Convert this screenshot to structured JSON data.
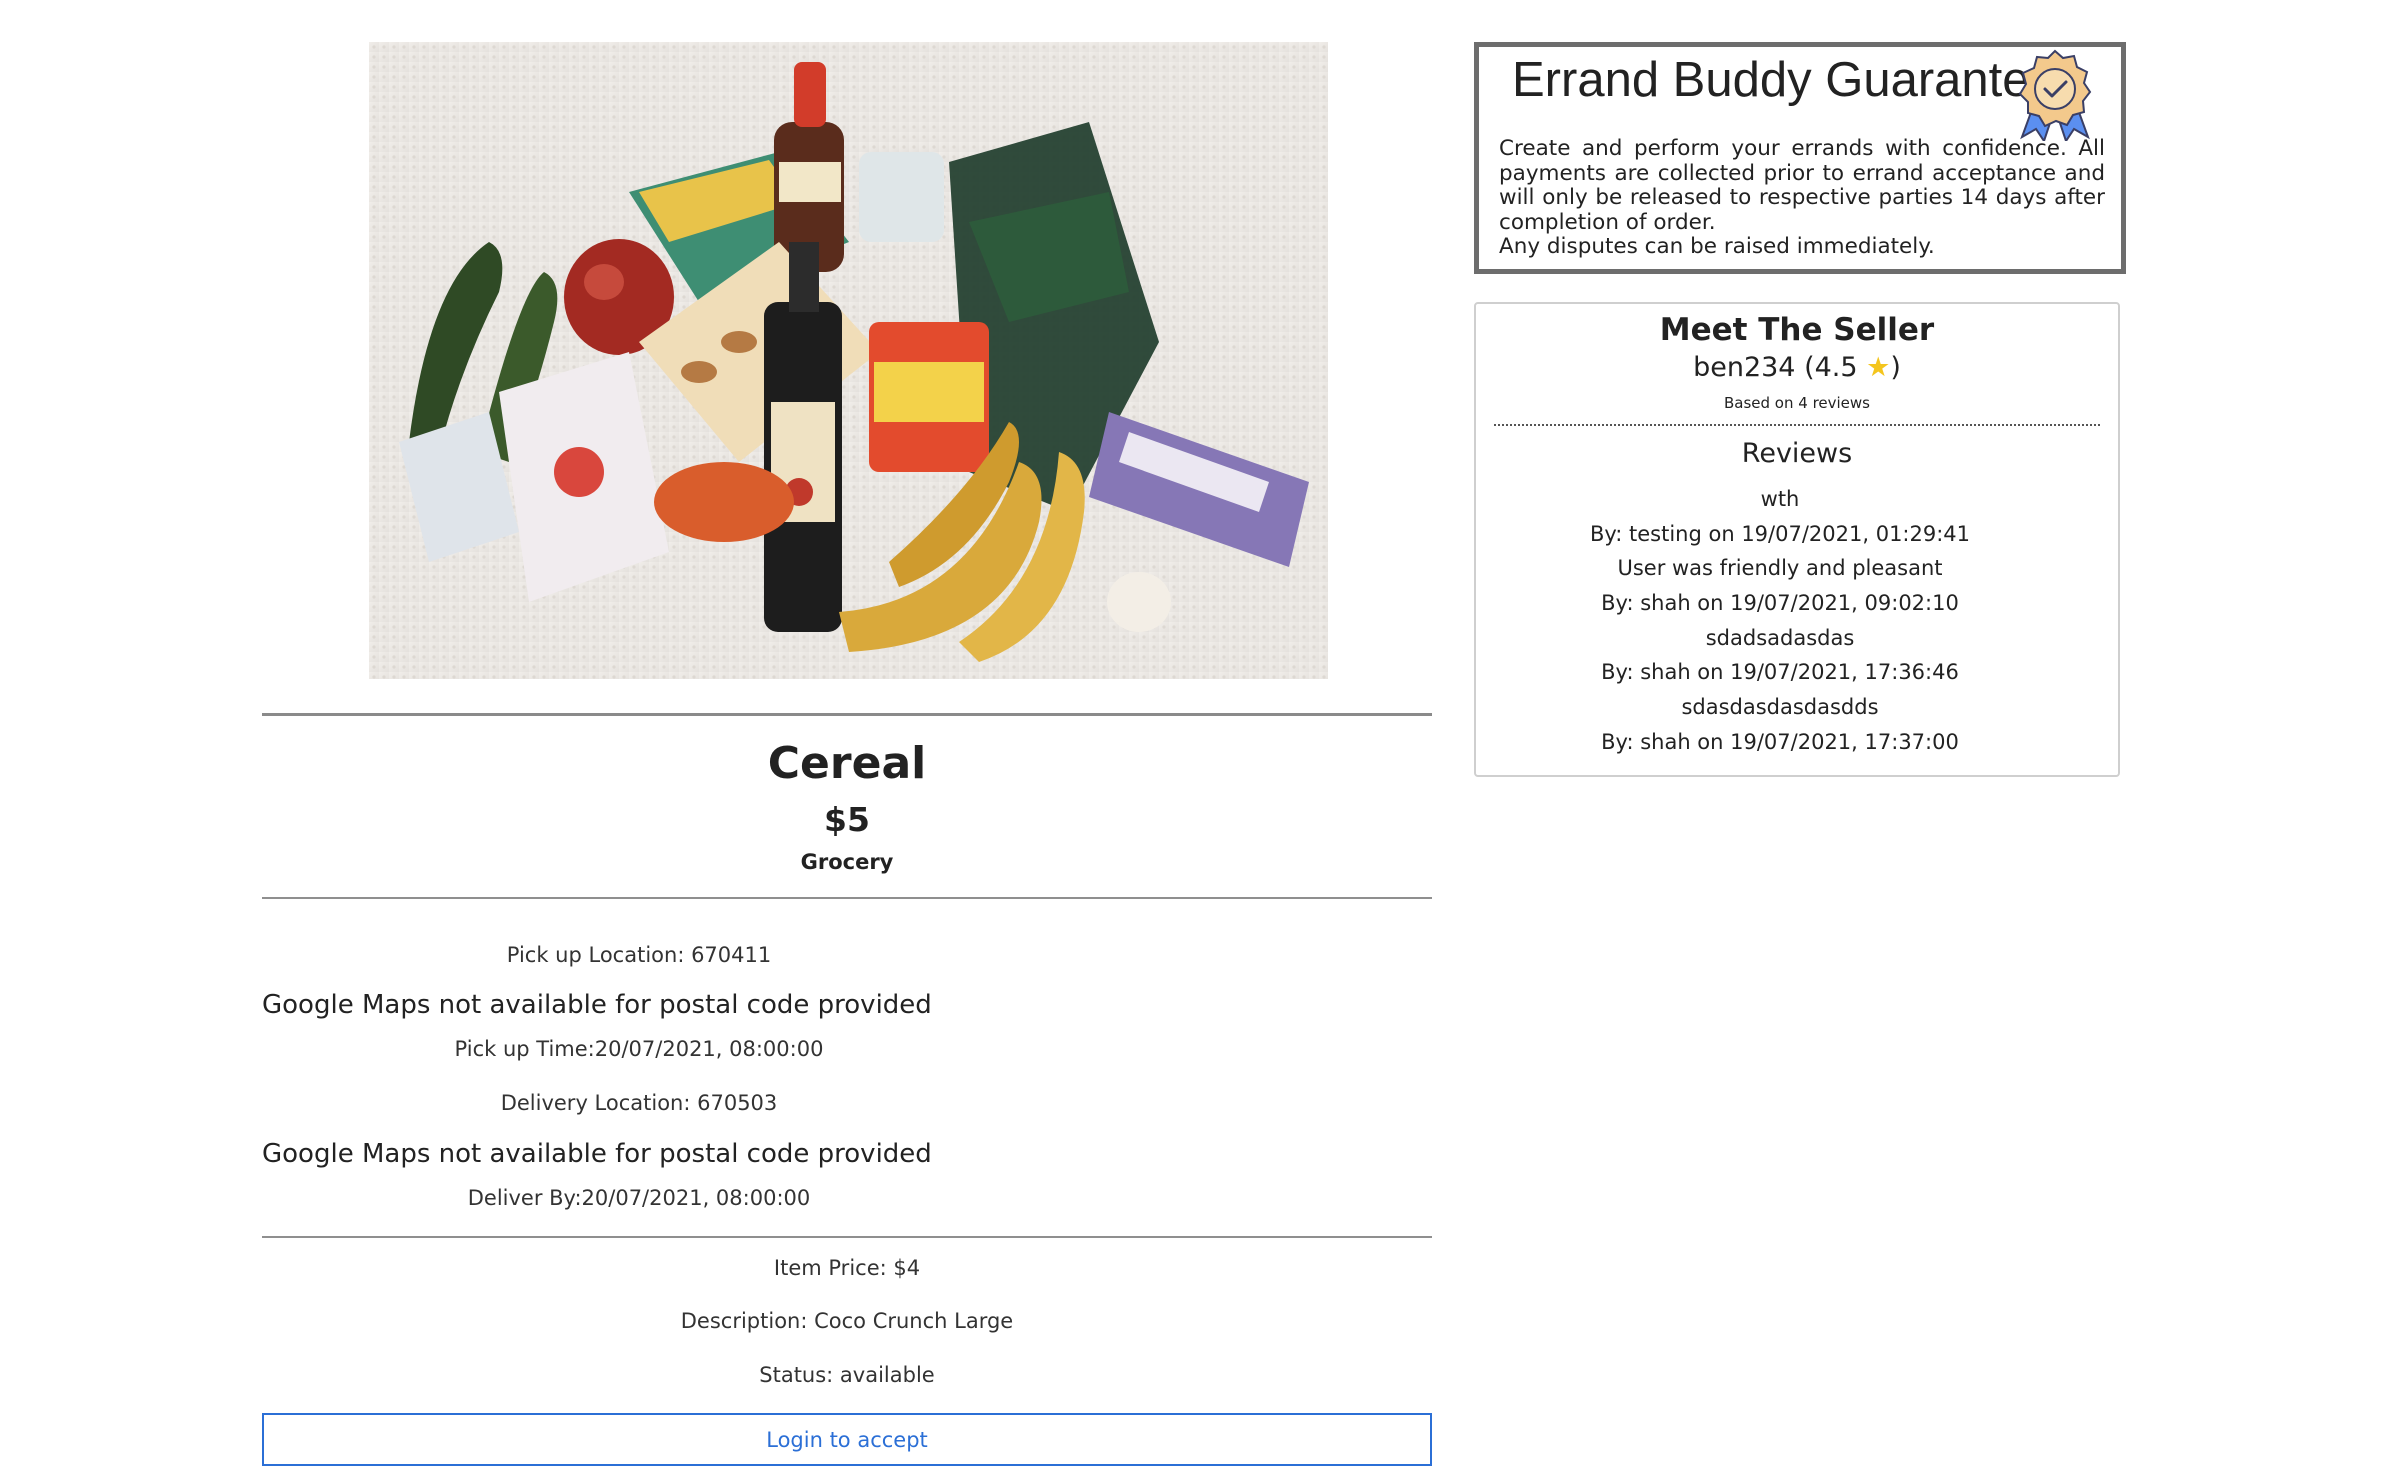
{
  "product": {
    "image_alt": "Groceries on a white blanket",
    "title": "Cereal",
    "price": "$5",
    "category": "Grocery"
  },
  "locations": {
    "pickup_location": "Pick up Location: 670411",
    "pickup_map_message": "Google Maps not available for postal code provided",
    "pickup_time": "Pick up Time:20/07/2021, 08:00:00",
    "delivery_location": "Delivery Location: 670503",
    "delivery_map_message": "Google Maps not available for postal code provided",
    "deliver_by": "Deliver By:20/07/2021, 08:00:00"
  },
  "details": {
    "item_price": "Item Price: $4",
    "description": "Description: Coco Crunch Large",
    "status": "Status: available"
  },
  "actions": {
    "login_label": "Login to accept"
  },
  "guarantee": {
    "title": "Errand Buddy Guarantee",
    "body": "Create and perform your errands with confidence. All payments are collected prior to errand acceptance and will only be released to respective parties 14 days after completion of order.",
    "disputes": "Any disputes can be raised immediately."
  },
  "seller": {
    "heading": "Meet The Seller",
    "username": "ben234",
    "rating": "4.5",
    "based_on": "Based on 4 reviews",
    "reviews_heading": "Reviews",
    "reviews": [
      {
        "text": "wth",
        "byline": "By: testing on 19/07/2021, 01:29:41"
      },
      {
        "text": "User was friendly and pleasant",
        "byline": "By: shah on 19/07/2021, 09:02:10"
      },
      {
        "text": "sdadsadasdas",
        "byline": "By: shah on 19/07/2021, 17:36:46"
      },
      {
        "text": "sdasdasdasdasdds",
        "byline": "By: shah on 19/07/2021, 17:37:00"
      }
    ]
  },
  "colors": {
    "accent": "#2b6fd6",
    "border": "#6d6d6d",
    "star": "#f4c51d"
  },
  "icons": {
    "medal": "award-medal-icon",
    "star": "star-icon"
  }
}
